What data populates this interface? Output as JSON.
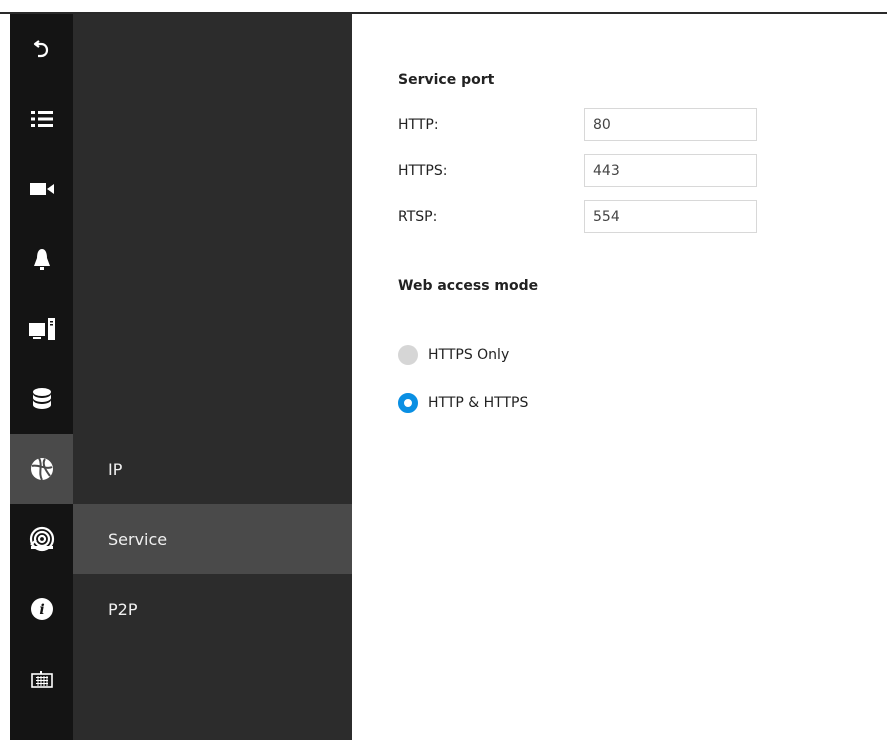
{
  "sidebar": {
    "icons": [
      "back-icon",
      "list-icon",
      "video-camera-icon",
      "bell-icon",
      "monitor-icon",
      "database-icon",
      "network-globe-icon",
      "security-icon",
      "info-icon",
      "keyboard-icon"
    ],
    "active_index": 6,
    "accent_color": "#0a8fe3"
  },
  "submenu": {
    "items": [
      {
        "label": "IP"
      },
      {
        "label": "Service"
      },
      {
        "label": "P2P"
      }
    ],
    "active": "Service"
  },
  "service_port": {
    "title": "Service port",
    "fields": [
      {
        "label": "HTTP:",
        "value": "80"
      },
      {
        "label": "HTTPS:",
        "value": "443"
      },
      {
        "label": "RTSP:",
        "value": "554"
      }
    ]
  },
  "web_access": {
    "title": "Web access mode",
    "options": [
      {
        "label": "HTTPS Only",
        "selected": false
      },
      {
        "label": "HTTP & HTTPS",
        "selected": true
      }
    ]
  }
}
